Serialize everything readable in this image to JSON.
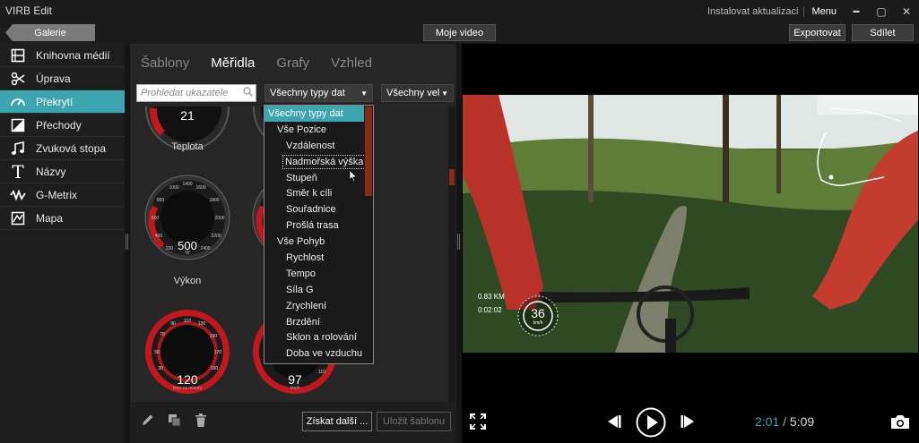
{
  "app": {
    "title": "VIRB Edit",
    "install_update": "Instalovat aktualizaci",
    "menu": "Menu"
  },
  "window": {
    "minimize": "▬",
    "maximize": "▢",
    "close": "✕"
  },
  "toolbar": {
    "gallery": "Galerie",
    "my_video": "Moje video",
    "export": "Exportovat",
    "share": "Sdílet"
  },
  "sidebar": {
    "items": [
      {
        "label": "Knihovna médií",
        "icon": "film-strip-icon"
      },
      {
        "label": "Úprava",
        "icon": "scissors-icon"
      },
      {
        "label": "Překrytí",
        "icon": "gauge-icon"
      },
      {
        "label": "Přechody",
        "icon": "transition-icon"
      },
      {
        "label": "Zvuková stopa",
        "icon": "music-note-icon"
      },
      {
        "label": "Názvy",
        "icon": "title-t-icon"
      },
      {
        "label": "G-Metrix",
        "icon": "g-metrix-icon"
      },
      {
        "label": "Mapa",
        "icon": "map-icon"
      }
    ],
    "active_index": 2
  },
  "panel": {
    "tabs": [
      "Šablony",
      "Měřidla",
      "Grafy",
      "Vzhled"
    ],
    "active_tab": 1,
    "search_placeholder": "Prohledat ukazatele",
    "filter_type": "Všechny typy dat",
    "filter_size": "Všechny vel",
    "gauges": [
      {
        "label": "Teplota",
        "value": "21"
      },
      {
        "label": "Výkon",
        "value": "500",
        "unit": "W"
      },
      {
        "label": "",
        "value": "120",
        "unit": "tepy za minutu"
      },
      {
        "label": "",
        "value": "97",
        "unit": "km/h"
      }
    ],
    "bottom": {
      "get_more": "Získat další ...",
      "save_template": "Uložit šablonu"
    }
  },
  "dropdown": {
    "items": [
      {
        "label": "Všechny typy dat",
        "level": 0,
        "selected": true
      },
      {
        "label": "Vše Pozice",
        "level": 1
      },
      {
        "label": "Vzdálenost",
        "level": 2
      },
      {
        "label": "Nadmořská výška",
        "level": 2,
        "focused": true
      },
      {
        "label": "Stupeň",
        "level": 2
      },
      {
        "label": "Směr k cíli",
        "level": 2
      },
      {
        "label": "Souřadnice",
        "level": 2
      },
      {
        "label": "Prošlá trasa",
        "level": 2
      },
      {
        "label": "Vše Pohyb",
        "level": 1
      },
      {
        "label": "Rychlost",
        "level": 2
      },
      {
        "label": "Tempo",
        "level": 2
      },
      {
        "label": "Síla G",
        "level": 2
      },
      {
        "label": "Zrychlení",
        "level": 2
      },
      {
        "label": "Brzdění",
        "level": 2
      },
      {
        "label": "Sklon a rolování",
        "level": 2
      },
      {
        "label": "Doba ve vzduchu",
        "level": 2
      }
    ]
  },
  "video": {
    "overlay_distance": "0.83 KM",
    "overlay_time": "0:02:02",
    "overlay_speed": "36",
    "overlay_speed_unit": "km/h",
    "time_current": "2:01",
    "time_separator": "/",
    "time_total": "5:09"
  },
  "colors": {
    "accent": "#3ca5b0",
    "gauge_red": "#c0181c"
  }
}
